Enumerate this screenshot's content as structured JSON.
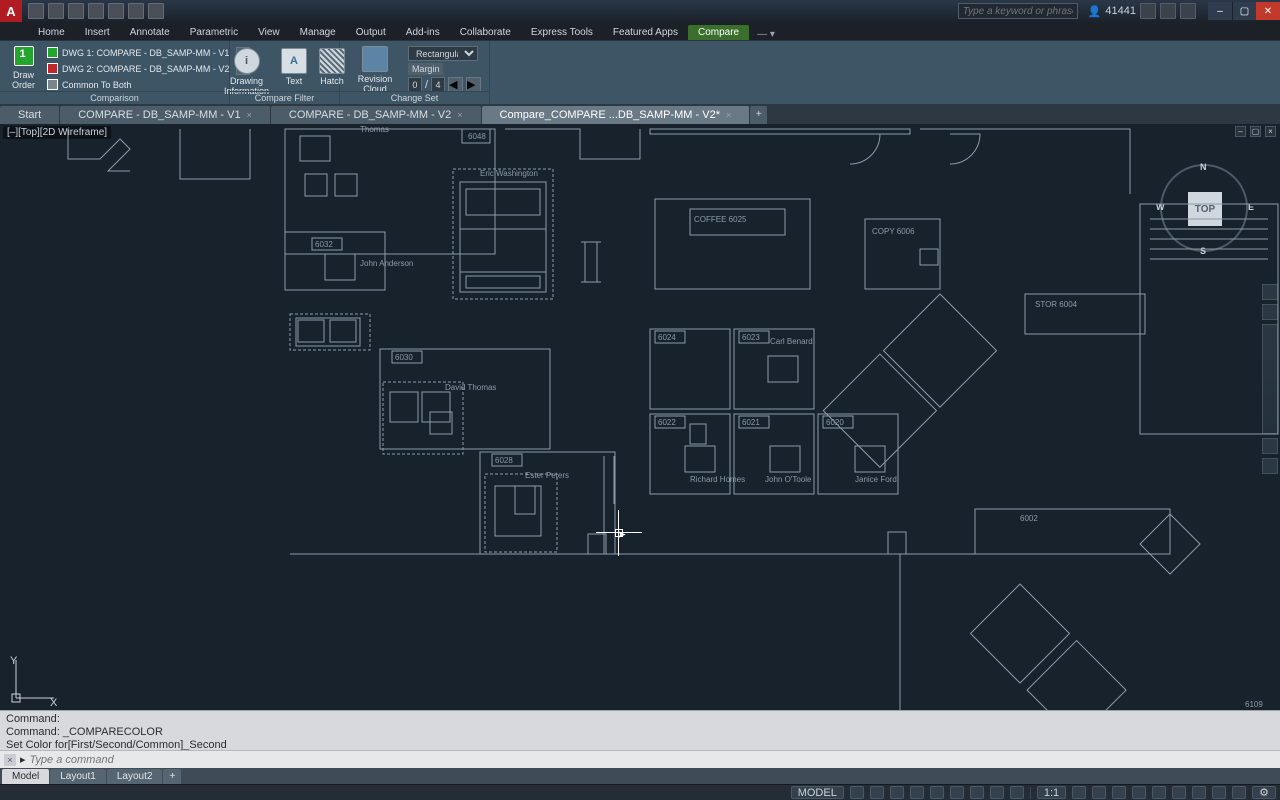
{
  "app": {
    "logo_letter": "A"
  },
  "titlebar": {
    "search_placeholder": "Type a keyword or phrase",
    "user_label": "41441",
    "user_icon_label": "👤"
  },
  "window_controls": {
    "min": "–",
    "max": "▢",
    "close": "✕"
  },
  "ribbon_tabs": {
    "items": [
      "Home",
      "Insert",
      "Annotate",
      "Parametric",
      "View",
      "Manage",
      "Output",
      "Add-ins",
      "Collaborate",
      "Express Tools",
      "Featured Apps",
      "Compare"
    ],
    "active_index": 11,
    "extra": "—  ▾"
  },
  "ribbon": {
    "panel_comparison": {
      "title": "Comparison",
      "draw_order_label": "Draw\nOrder",
      "draw_order_badge": "1",
      "rows": [
        {
          "label": "DWG 1:  COMPARE - DB_SAMP-MM - V1"
        },
        {
          "label": "DWG 2:  COMPARE - DB_SAMP-MM - V2"
        },
        {
          "label": "Common To Both"
        }
      ],
      "info_label": "Drawing\nInformation"
    },
    "panel_filter": {
      "title": "Compare Filter",
      "text_label": "Text",
      "hatch_label": "Hatch"
    },
    "panel_changeset": {
      "title": "Change Set",
      "revcloud_label": "Revision\nCloud",
      "shape_select": "Rectangular",
      "margin_label": "Margin",
      "pos_current": "0",
      "pos_sep": "/",
      "pos_total": "4"
    }
  },
  "file_tabs": {
    "items": [
      {
        "label": "Start",
        "active": false
      },
      {
        "label": "COMPARE - DB_SAMP-MM - V1",
        "active": false
      },
      {
        "label": "COMPARE - DB_SAMP-MM - V2",
        "active": false
      },
      {
        "label": "Compare_COMPARE ...DB_SAMP-MM - V2*",
        "active": true
      }
    ],
    "add": "+"
  },
  "viewport": {
    "control_label": "[–][Top][2D Wireframe]",
    "navcube_face": "TOP",
    "nav_N": "N",
    "nav_S": "S",
    "nav_E": "E",
    "nav_W": "W",
    "ucs_x": "X",
    "ucs_y": "Y"
  },
  "plan_labels": {
    "thomas": "Thomas",
    "eric_washington": "Eric\nWashington",
    "john_anderson": "John\nAnderson",
    "david_thomas": "David\nThomas",
    "ester_peters": "Ester\nPeters",
    "carl_benard": "Carl\nBenard",
    "richard_homes": "Richard\nHomes",
    "john_otoole": "John\nO'Toole",
    "janice_ford": "Janice\nFord",
    "coffee": "COFFEE\n6025",
    "copy": "COPY\n6006",
    "stor": "STOR\n6004",
    "r6048": "6048",
    "r6032": "6032",
    "r6030": "6030",
    "r6028": "6028",
    "r6024": "6024",
    "r6023": "6023",
    "r6022": "6022",
    "r6021": "6021",
    "r6020": "6020",
    "r6002": "6002",
    "r6109": "6109"
  },
  "command": {
    "line1": "Command:",
    "line2": "Command:  _COMPARECOLOR",
    "line3": "Set Color for[First/Second/Common]_Second",
    "prompt_icon": "▸",
    "placeholder": "Type a command"
  },
  "layout_tabs": {
    "items": [
      "Model",
      "Layout1",
      "Layout2"
    ],
    "active_index": 0,
    "add": "+"
  },
  "statusbar": {
    "model": "MODEL",
    "scale": "1:1",
    "gear": "⚙"
  }
}
